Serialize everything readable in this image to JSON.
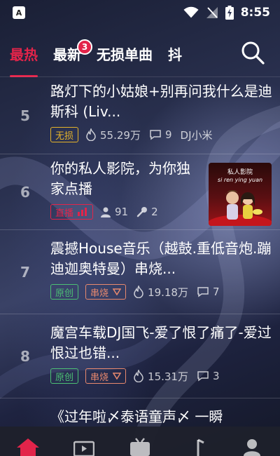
{
  "status_bar": {
    "app_icon_letter": "A",
    "time": "8:55"
  },
  "tabs": [
    {
      "label": "最热",
      "active": true
    },
    {
      "label": "最新",
      "badge": "3"
    },
    {
      "label": "无损单曲"
    },
    {
      "label": "抖"
    }
  ],
  "list": {
    "rows": [
      {
        "rank": "5",
        "title": "路灯下的小姑娘+别再问我什么是迪斯科 (Liv...",
        "tags": [
          "无损"
        ],
        "plays": "55.29万",
        "comments": "9",
        "author": "DJ小米"
      },
      {
        "rank": "6",
        "title": "你的私人影院，为你独家点播",
        "tags": [
          "直播"
        ],
        "listeners": "91",
        "hosts": "2",
        "thumbnail": {
          "title": "私人影院",
          "subtitle": "si ren ying yuan"
        }
      },
      {
        "rank": "7",
        "title": "震撼House音乐（越鼓.重低音炮.蹦迪迦奥特曼）串烧...",
        "tags": [
          "原创",
          "串烧"
        ],
        "plays": "19.18万",
        "comments": "7"
      },
      {
        "rank": "8",
        "title": "魔宫车载DJ国飞-爱了恨了痛了-爱过恨过也错...",
        "tags": [
          "原创",
          "串烧"
        ],
        "plays": "15.31万",
        "comments": "3"
      },
      {
        "rank": "",
        "title": "《过年啦〆泰语童声〆 一瞬"
      }
    ]
  },
  "bottom_nav": [
    {
      "icon": "home-icon",
      "active": true
    },
    {
      "icon": "video-icon"
    },
    {
      "icon": "tv-icon"
    },
    {
      "icon": "music-icon"
    },
    {
      "icon": "profile-icon"
    }
  ],
  "colors": {
    "accent": "#e3244a",
    "lossless": "#e6b42a",
    "original": "#4cbf74",
    "medley": "#e8896e"
  }
}
